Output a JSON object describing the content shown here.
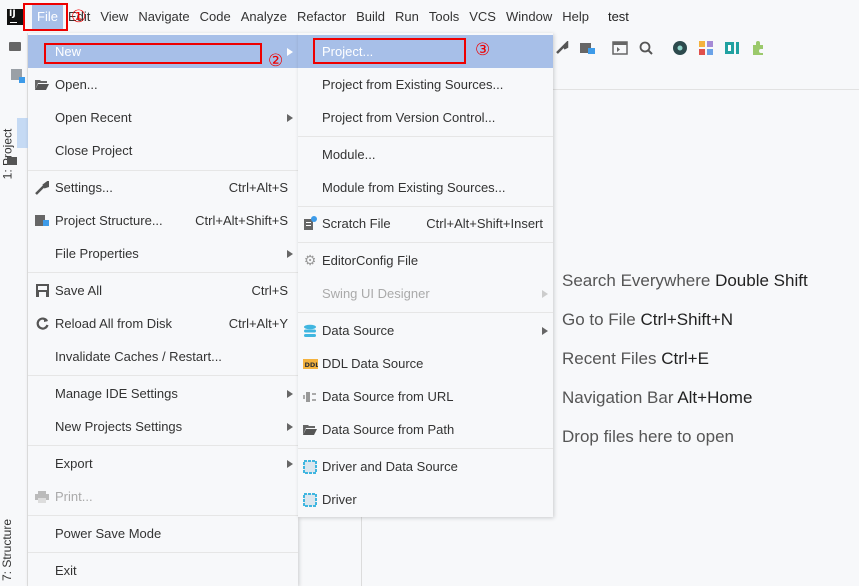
{
  "menubar": {
    "items": [
      "File",
      "Edit",
      "View",
      "Navigate",
      "Code",
      "Analyze",
      "Refactor",
      "Build",
      "Run",
      "Tools",
      "VCS",
      "Window",
      "Help"
    ],
    "project_title": "test"
  },
  "annotations": [
    "①",
    "②",
    "③"
  ],
  "left_strip": {
    "project_tab": "1: Project",
    "structure_tab": "7: Structure"
  },
  "file_menu": {
    "items": [
      {
        "label": "New",
        "selected": true,
        "submenu": true
      },
      {
        "label": "Open...",
        "icon": "folder-open-icon"
      },
      {
        "label": "Open Recent",
        "submenu": true
      },
      {
        "label": "Close Project"
      },
      {
        "label": "Settings...",
        "shortcut": "Ctrl+Alt+S",
        "icon": "wrench-icon"
      },
      {
        "label": "Project Structure...",
        "shortcut": "Ctrl+Alt+Shift+S",
        "icon": "project-structure-icon"
      },
      {
        "label": "File Properties",
        "submenu": true
      },
      {
        "label": "Save All",
        "shortcut": "Ctrl+S",
        "icon": "save-icon"
      },
      {
        "label": "Reload All from Disk",
        "shortcut": "Ctrl+Alt+Y",
        "icon": "reload-icon"
      },
      {
        "label": "Invalidate Caches / Restart..."
      },
      {
        "label": "Manage IDE Settings",
        "submenu": true
      },
      {
        "label": "New Projects Settings",
        "submenu": true
      },
      {
        "label": "Export",
        "submenu": true
      },
      {
        "label": "Print...",
        "disabled": true,
        "icon": "print-icon"
      },
      {
        "label": "Power Save Mode"
      },
      {
        "label": "Exit"
      }
    ]
  },
  "new_menu": {
    "items": [
      {
        "label": "Project...",
        "selected": true
      },
      {
        "label": "Project from Existing Sources..."
      },
      {
        "label": "Project from Version Control..."
      },
      {
        "label": "Module..."
      },
      {
        "label": "Module from Existing Sources..."
      },
      {
        "label": "Scratch File",
        "shortcut": "Ctrl+Alt+Shift+Insert",
        "icon": "scratch-file-icon"
      },
      {
        "label": "EditorConfig File",
        "icon": "gear-icon"
      },
      {
        "label": "Swing UI Designer",
        "disabled": true,
        "submenu": true
      },
      {
        "label": "Data Source",
        "submenu": true,
        "icon": "database-icon"
      },
      {
        "label": "DDL Data Source",
        "icon": "ddl-icon"
      },
      {
        "label": "Data Source from URL",
        "icon": "url-icon"
      },
      {
        "label": "Data Source from Path",
        "icon": "folder-icon"
      },
      {
        "label": "Driver and Data Source",
        "icon": "driver-icon"
      },
      {
        "label": "Driver",
        "icon": "driver-icon"
      }
    ]
  },
  "hints": [
    {
      "text": "Search Everywhere",
      "key": "Double Shift"
    },
    {
      "text": "Go to File",
      "key": "Ctrl+Shift+N"
    },
    {
      "text": "Recent Files",
      "key": "Ctrl+E"
    },
    {
      "text": "Navigation Bar",
      "key": "Alt+Home"
    },
    {
      "text": "Drop files here to open",
      "key": ""
    }
  ]
}
